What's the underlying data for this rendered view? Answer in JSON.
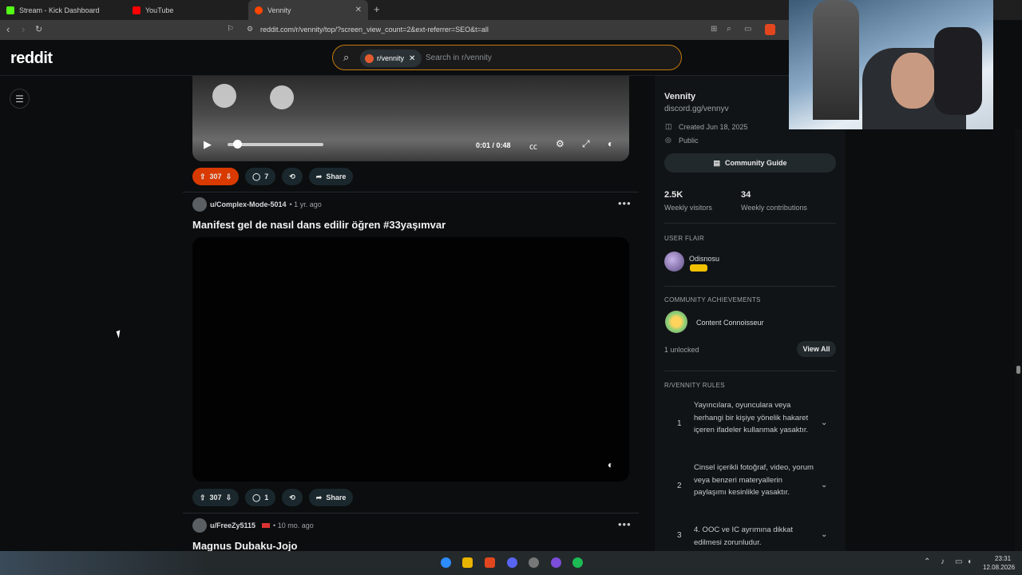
{
  "browser": {
    "tabs": [
      {
        "label": "Stream - Kick Dashboard",
        "favicon_color": "#53fc18"
      },
      {
        "label": "YouTube",
        "favicon_color": "#ff0000"
      },
      {
        "label": "Vennity",
        "favicon_color": "#ff4500"
      }
    ],
    "url": "reddit.com/r/vennity/top/?screen_view_count=2&ext-referrer=SEO&t=all"
  },
  "header": {
    "logo": "reddit",
    "search_chip": "r/vennity",
    "search_placeholder": "Search in r/vennity"
  },
  "posts": [
    {
      "video_time": "0:01 / 0:48",
      "votes": "307",
      "comments": "7",
      "share": "Share",
      "upvoted": true
    },
    {
      "user": "u/Complex-Mode-5014",
      "age": "• 1 yr. ago",
      "title": "Manifest gel de nasıl dans edilir öğren #33yaşımvar",
      "votes": "307",
      "comments": "1",
      "share": "Share"
    },
    {
      "user": "u/FreeZy5115",
      "age": "• 10 mo. ago",
      "title": "Magnus Dubaku-Jojo"
    }
  ],
  "sidebar": {
    "name": "Vennity",
    "link": "discord.gg/vennyv",
    "created": "Created Jun 18, 2025",
    "visibility": "Public",
    "guide_button": "Community Guide",
    "stats": [
      {
        "value": "2.5K",
        "label": "Weekly visitors"
      },
      {
        "value": "34",
        "label": "Weekly contributions"
      }
    ],
    "user_flair_head": "USER FLAIR",
    "flair_user": "Odisnosu",
    "achievements_head": "COMMUNITY ACHIEVEMENTS",
    "achievement": "Content Connoisseur",
    "unlocked": "1 unlocked",
    "view_all": "View All",
    "rules_head": "R/VENNITY RULES",
    "rules": [
      {
        "num": "1",
        "text": "Yayıncılara, oyunculara veya herhangi bir kişiye yönelik hakaret içeren ifadeler kullanmak yasaktır."
      },
      {
        "num": "2",
        "text": "Cinsel içerikli fotoğraf, video, yorum veya benzeri materyallerin paylaşımı kesinlikle yasaktır."
      },
      {
        "num": "3",
        "text": "4. OOC ve IC ayrımına dikkat edilmesi zorunludur."
      }
    ]
  },
  "taskbar": {
    "time": "23:31",
    "date": "12.08.2026"
  },
  "colors": {
    "accent": "#d93a00",
    "search_border": "#c47a0a",
    "background": "#0b0d0e"
  }
}
